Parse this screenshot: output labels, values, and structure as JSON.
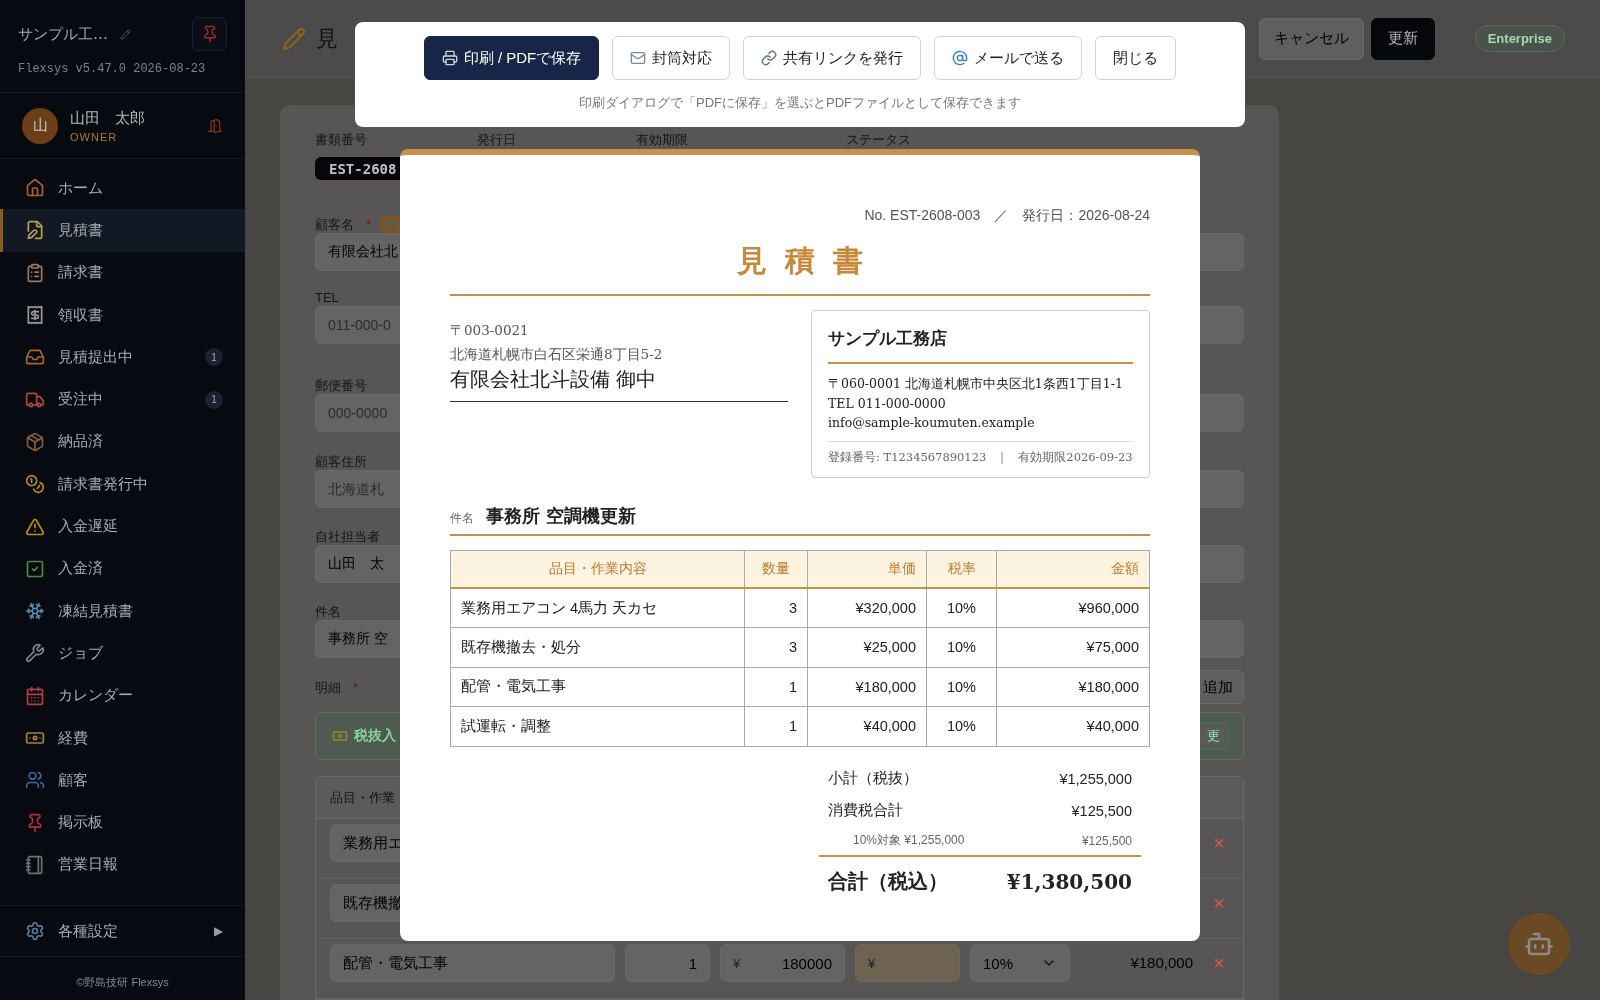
{
  "sidebar": {
    "brand": "サンプル工…",
    "version": "Flexsys v5.47.0 2026-08-23",
    "user": {
      "avatar": "山",
      "name": "山田　太郎",
      "role": "OWNER"
    },
    "nav": [
      {
        "label": "ホーム",
        "selected": false
      },
      {
        "label": "見積書",
        "selected": true
      },
      {
        "label": "請求書",
        "selected": false
      },
      {
        "label": "領収書",
        "selected": false
      },
      {
        "label": "見積提出中",
        "badge": "1",
        "selected": false
      },
      {
        "label": "受注中",
        "badge": "1",
        "selected": false
      },
      {
        "label": "納品済",
        "selected": false
      },
      {
        "label": "請求書発行中",
        "selected": false
      },
      {
        "label": "入金遅延",
        "selected": false
      },
      {
        "label": "入金済",
        "selected": false
      },
      {
        "label": "凍結見積書",
        "selected": false
      },
      {
        "label": "ジョブ",
        "selected": false
      },
      {
        "label": "カレンダー",
        "selected": false
      },
      {
        "label": "経費",
        "selected": false
      },
      {
        "label": "顧客",
        "selected": false
      },
      {
        "label": "掲示板",
        "selected": false
      },
      {
        "label": "営業日報",
        "selected": false
      }
    ],
    "settings": {
      "label": "各種設定",
      "arrow": "▶"
    },
    "footer": "©野島技研 Flexsys"
  },
  "header": {
    "title": "見",
    "actions": [
      {
        "label": "キャンセル",
        "kind": "secondary"
      },
      {
        "label": "更新",
        "kind": "primary"
      }
    ],
    "plan": "Enterprise"
  },
  "form": {
    "doc_labels": [
      "書類番号",
      "発行日",
      "有効期限",
      "ステータス"
    ],
    "doc_number": "EST-2608",
    "fields": [
      {
        "kind": "customer",
        "label": "顧客名",
        "required_mark": "*",
        "value": "有限会社北"
      },
      {
        "kind": "text",
        "label": "TEL",
        "placeholder": "011-000-0"
      },
      {
        "kind": "text",
        "label": "郵便番号",
        "placeholder": "000-0000"
      },
      {
        "kind": "text",
        "label": "顧客住所",
        "placeholder": "北海道札"
      },
      {
        "kind": "text",
        "label": "自社担当者",
        "value": "山田　太"
      },
      {
        "kind": "text",
        "label": "件名",
        "value": "事務所 空"
      }
    ],
    "details": {
      "label": "明細",
      "required_mark": "*",
      "add_button": "追加",
      "banner": "税抜入",
      "change_button": "更",
      "column_1": "品目・作業",
      "rows": [
        {
          "kind": "partial",
          "name": "業務用エ",
          "remove": "×"
        },
        {
          "kind": "partial",
          "name": "既存機撤",
          "remove": "×"
        },
        {
          "kind": "full",
          "name": "配管・電気工事",
          "qty": "1",
          "currency": "¥",
          "price": "180000",
          "cost_currency": "¥",
          "tax": "10%",
          "amount": "¥180,000",
          "remove": "×"
        }
      ]
    }
  },
  "modal": {
    "actions": [
      {
        "label": "印刷 / PDFで保存",
        "kind": "primary"
      },
      {
        "label": "封筒対応",
        "kind": "secondary"
      },
      {
        "label": "共有リンクを発行",
        "kind": "secondary"
      },
      {
        "label": "メールで送る",
        "kind": "secondary"
      },
      {
        "label": "閉じる",
        "kind": "secondary"
      }
    ],
    "hint": "印刷ダイアログで「PDFに保存」を選ぶとPDFファイルとして保存できます"
  },
  "document": {
    "number": "No. EST-2608-003",
    "separator": "／",
    "issue_date": "発行日：2026-08-24",
    "title": "見積書",
    "recipient": {
      "postal": "〒003-0021",
      "address": "北海道札幌市白石区栄通8丁目5-2",
      "name": "有限会社北斗設備 御中"
    },
    "issuer": {
      "name": "サンプル工務店",
      "address": "〒060-0001 北海道札幌市中央区北1条西1丁目1-1",
      "tel": "TEL 011-000-0000",
      "email": "info@sample-koumuten.example",
      "registration": "登録番号: T1234567890123",
      "separator": "｜",
      "valid_until": "有効期限2026-09-23"
    },
    "subject": {
      "label": "件名",
      "value": "事務所 空調機更新"
    },
    "columns": [
      "品目・作業内容",
      "数量",
      "単価",
      "税率",
      "金額"
    ],
    "rows": [
      [
        "業務用エアコン 4馬力 天カセ",
        "3",
        "¥320,000",
        "10%",
        "¥960,000"
      ],
      [
        "既存機撤去・処分",
        "3",
        "¥25,000",
        "10%",
        "¥75,000"
      ],
      [
        "配管・電気工事",
        "1",
        "¥180,000",
        "10%",
        "¥180,000"
      ],
      [
        "試運転・調整",
        "1",
        "¥40,000",
        "10%",
        "¥40,000"
      ]
    ],
    "totals": [
      {
        "kind": "line",
        "label": "小計（税抜）",
        "value": "¥1,255,000"
      },
      {
        "kind": "line",
        "label": "消費税合計",
        "value": "¥125,500"
      },
      {
        "kind": "detail",
        "label": "10%対象 ¥1,255,000",
        "value": "¥125,500"
      }
    ],
    "grand_total": {
      "label": "合計（税込）",
      "value": "¥1,380,500"
    }
  }
}
